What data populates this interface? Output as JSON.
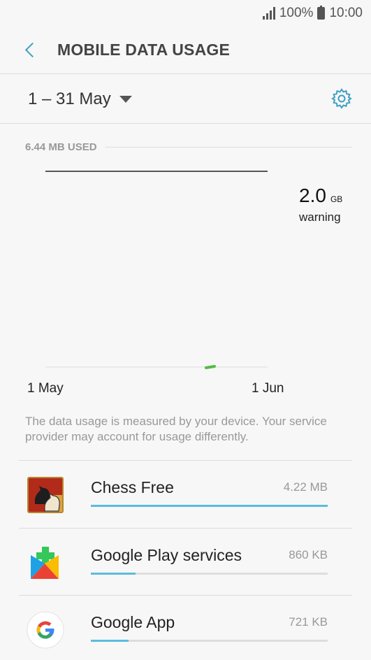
{
  "status": {
    "battery": "100%",
    "time": "10:00"
  },
  "header": {
    "title": "MOBILE DATA USAGE"
  },
  "period": {
    "label": "1 – 31 May"
  },
  "usage": {
    "used_label": "6.44 MB USED",
    "limit_value": "2.0",
    "limit_unit": "GB",
    "limit_label": "warning",
    "axis_start": "1 May",
    "axis_end": "1 Jun",
    "note": "The data usage is measured by your device. Your service provider may account for usage differently."
  },
  "apps": [
    {
      "name": "Chess Free",
      "size": "4.22 MB",
      "usage_fraction": 1.0,
      "icon": "chess-knight-icon"
    },
    {
      "name": "Google Play services",
      "size": "860 KB",
      "usage_fraction": 0.19,
      "icon": "google-play-services-icon"
    },
    {
      "name": "Google App",
      "size": "721 KB",
      "usage_fraction": 0.16,
      "icon": "google-g-icon"
    }
  ],
  "colors": {
    "accent": "#3f9fc3",
    "bar": "#5bbcdd",
    "usage_line": "#55bb44"
  }
}
